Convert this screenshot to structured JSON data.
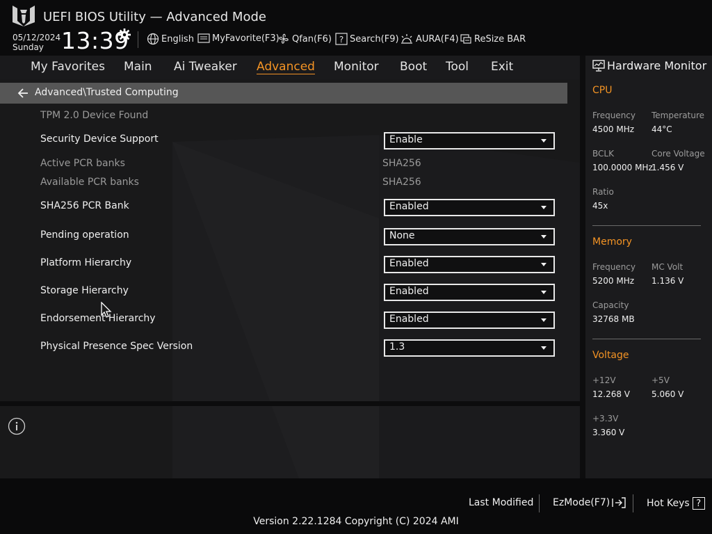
{
  "header": {
    "title": "UEFI BIOS Utility — Advanced Mode",
    "date": "05/12/2024",
    "day": "Sunday",
    "time": "13:39",
    "tools": [
      {
        "label": "English",
        "icon": "globe-icon"
      },
      {
        "label": "MyFavorite(F3)",
        "icon": "favorite-icon"
      },
      {
        "label": "Qfan(F6)",
        "icon": "fan-icon"
      },
      {
        "label": "Search(F9)",
        "icon": "search-icon"
      },
      {
        "label": "AURA(F4)",
        "icon": "aura-icon"
      },
      {
        "label": "ReSize BAR",
        "icon": "resize-bar-icon"
      }
    ]
  },
  "nav": {
    "tabs": [
      "My Favorites",
      "Main",
      "Ai Tweaker",
      "Advanced",
      "Monitor",
      "Boot",
      "Tool",
      "Exit"
    ],
    "active": "Advanced"
  },
  "breadcrumb": "Advanced\\Trusted Computing",
  "settings": {
    "tpm_found": "TPM 2.0 Device Found",
    "security_device_support": {
      "label": "Security Device Support",
      "value": "Enable"
    },
    "active_pcr_banks": {
      "label": "Active PCR banks",
      "value": "SHA256"
    },
    "available_pcr_banks": {
      "label": "Available PCR banks",
      "value": "SHA256"
    },
    "sha256_pcr_bank": {
      "label": "SHA256 PCR Bank",
      "value": "Enabled"
    },
    "pending_operation": {
      "label": "Pending operation",
      "value": "None"
    },
    "platform_hierarchy": {
      "label": "Platform Hierarchy",
      "value": "Enabled"
    },
    "storage_hierarchy": {
      "label": "Storage Hierarchy",
      "value": "Enabled"
    },
    "endorsement_hierarchy": {
      "label": "Endorsement Hierarchy",
      "value": "Enabled"
    },
    "physical_presence_spec_version": {
      "label": "Physical Presence Spec Version",
      "value": "1.3"
    }
  },
  "hardware_monitor": {
    "title": "Hardware Monitor",
    "cpu": {
      "heading": "CPU",
      "frequency_label": "Frequency",
      "frequency": "4500 MHz",
      "temperature_label": "Temperature",
      "temperature": "44°C",
      "bclk_label": "BCLK",
      "bclk": "100.0000 MHz",
      "core_voltage_label": "Core Voltage",
      "core_voltage": "1.456 V",
      "ratio_label": "Ratio",
      "ratio": "45x"
    },
    "memory": {
      "heading": "Memory",
      "frequency_label": "Frequency",
      "frequency": "5200 MHz",
      "mc_volt_label": "MC Volt",
      "mc_volt": "1.136 V",
      "capacity_label": "Capacity",
      "capacity": "32768 MB"
    },
    "voltage": {
      "heading": "Voltage",
      "v12_label": "+12V",
      "v12": "12.268 V",
      "v5_label": "+5V",
      "v5": "5.060 V",
      "v33_label": "+3.3V",
      "v33": "3.360 V"
    }
  },
  "footer": {
    "last_modified": "Last Modified",
    "ezmode": "EzMode(F7)",
    "hot_keys": "Hot Keys",
    "hot_keys_glyph": "?",
    "version": "Version 2.22.1284 Copyright (C) 2024 AMI"
  },
  "colors": {
    "accent": "#f39324",
    "breadcrumb_bar": "#565656"
  }
}
